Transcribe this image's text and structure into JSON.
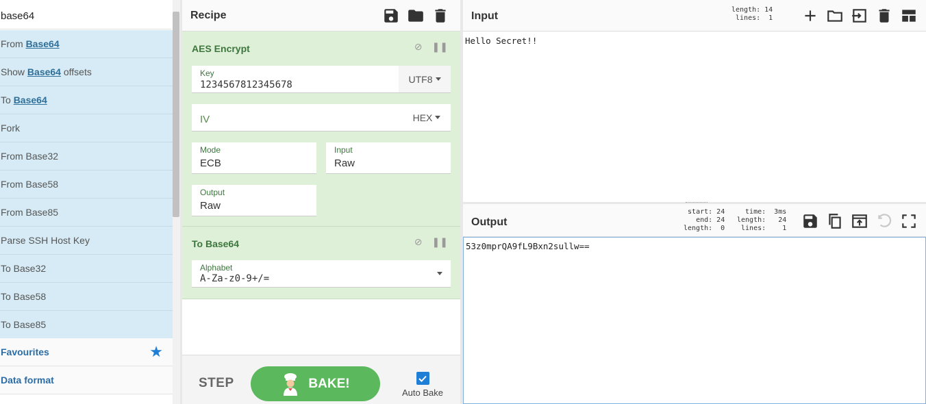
{
  "operations": {
    "search_value": "base64",
    "items": [
      {
        "pre": "From ",
        "hl": "Base64",
        "post": ""
      },
      {
        "pre": "Show ",
        "hl": "Base64",
        "post": " offsets"
      },
      {
        "pre": "To ",
        "hl": "Base64",
        "post": ""
      },
      {
        "pre": "Fork",
        "hl": "",
        "post": ""
      },
      {
        "pre": "From Base32",
        "hl": "",
        "post": ""
      },
      {
        "pre": "From Base58",
        "hl": "",
        "post": ""
      },
      {
        "pre": "From Base85",
        "hl": "",
        "post": ""
      },
      {
        "pre": "Parse SSH Host Key",
        "hl": "",
        "post": ""
      },
      {
        "pre": "To Base32",
        "hl": "",
        "post": ""
      },
      {
        "pre": "To Base58",
        "hl": "",
        "post": ""
      },
      {
        "pre": "To Base85",
        "hl": "",
        "post": ""
      }
    ],
    "categories": {
      "favourites": "Favourites",
      "data_format": "Data format"
    }
  },
  "recipe": {
    "title": "Recipe",
    "aes": {
      "title": "AES Encrypt",
      "key_label": "Key",
      "key_value": "1234567812345678",
      "key_encoding": "UTF8",
      "iv_placeholder": "IV",
      "iv_encoding": "HEX",
      "mode_label": "Mode",
      "mode_value": "ECB",
      "input_label": "Input",
      "input_value": "Raw",
      "output_label": "Output",
      "output_value": "Raw"
    },
    "tob64": {
      "title": "To Base64",
      "alphabet_label": "Alphabet",
      "alphabet_value": "A-Za-z0-9+/="
    },
    "step_label": "STEP",
    "bake_label": "BAKE!",
    "auto_bake_label": "Auto Bake",
    "auto_bake_checked": true
  },
  "input": {
    "title": "Input",
    "stats": "length: 14\n lines:  1",
    "text": "Hello Secret!!"
  },
  "output": {
    "title": "Output",
    "stats_a": "start: 24\n  end: 24\nlength:  0",
    "stats_b": "  time:  3ms\nlength:   24\n lines:    1",
    "text": "53z0mprQA9fL9Bxn2sullw=="
  },
  "colors": {
    "accent": "#1f7ed6",
    "op_bg": "#dff0d8",
    "op_title": "#3c763d",
    "bake": "#5cb85c",
    "match_bg": "#d6ebf5"
  }
}
